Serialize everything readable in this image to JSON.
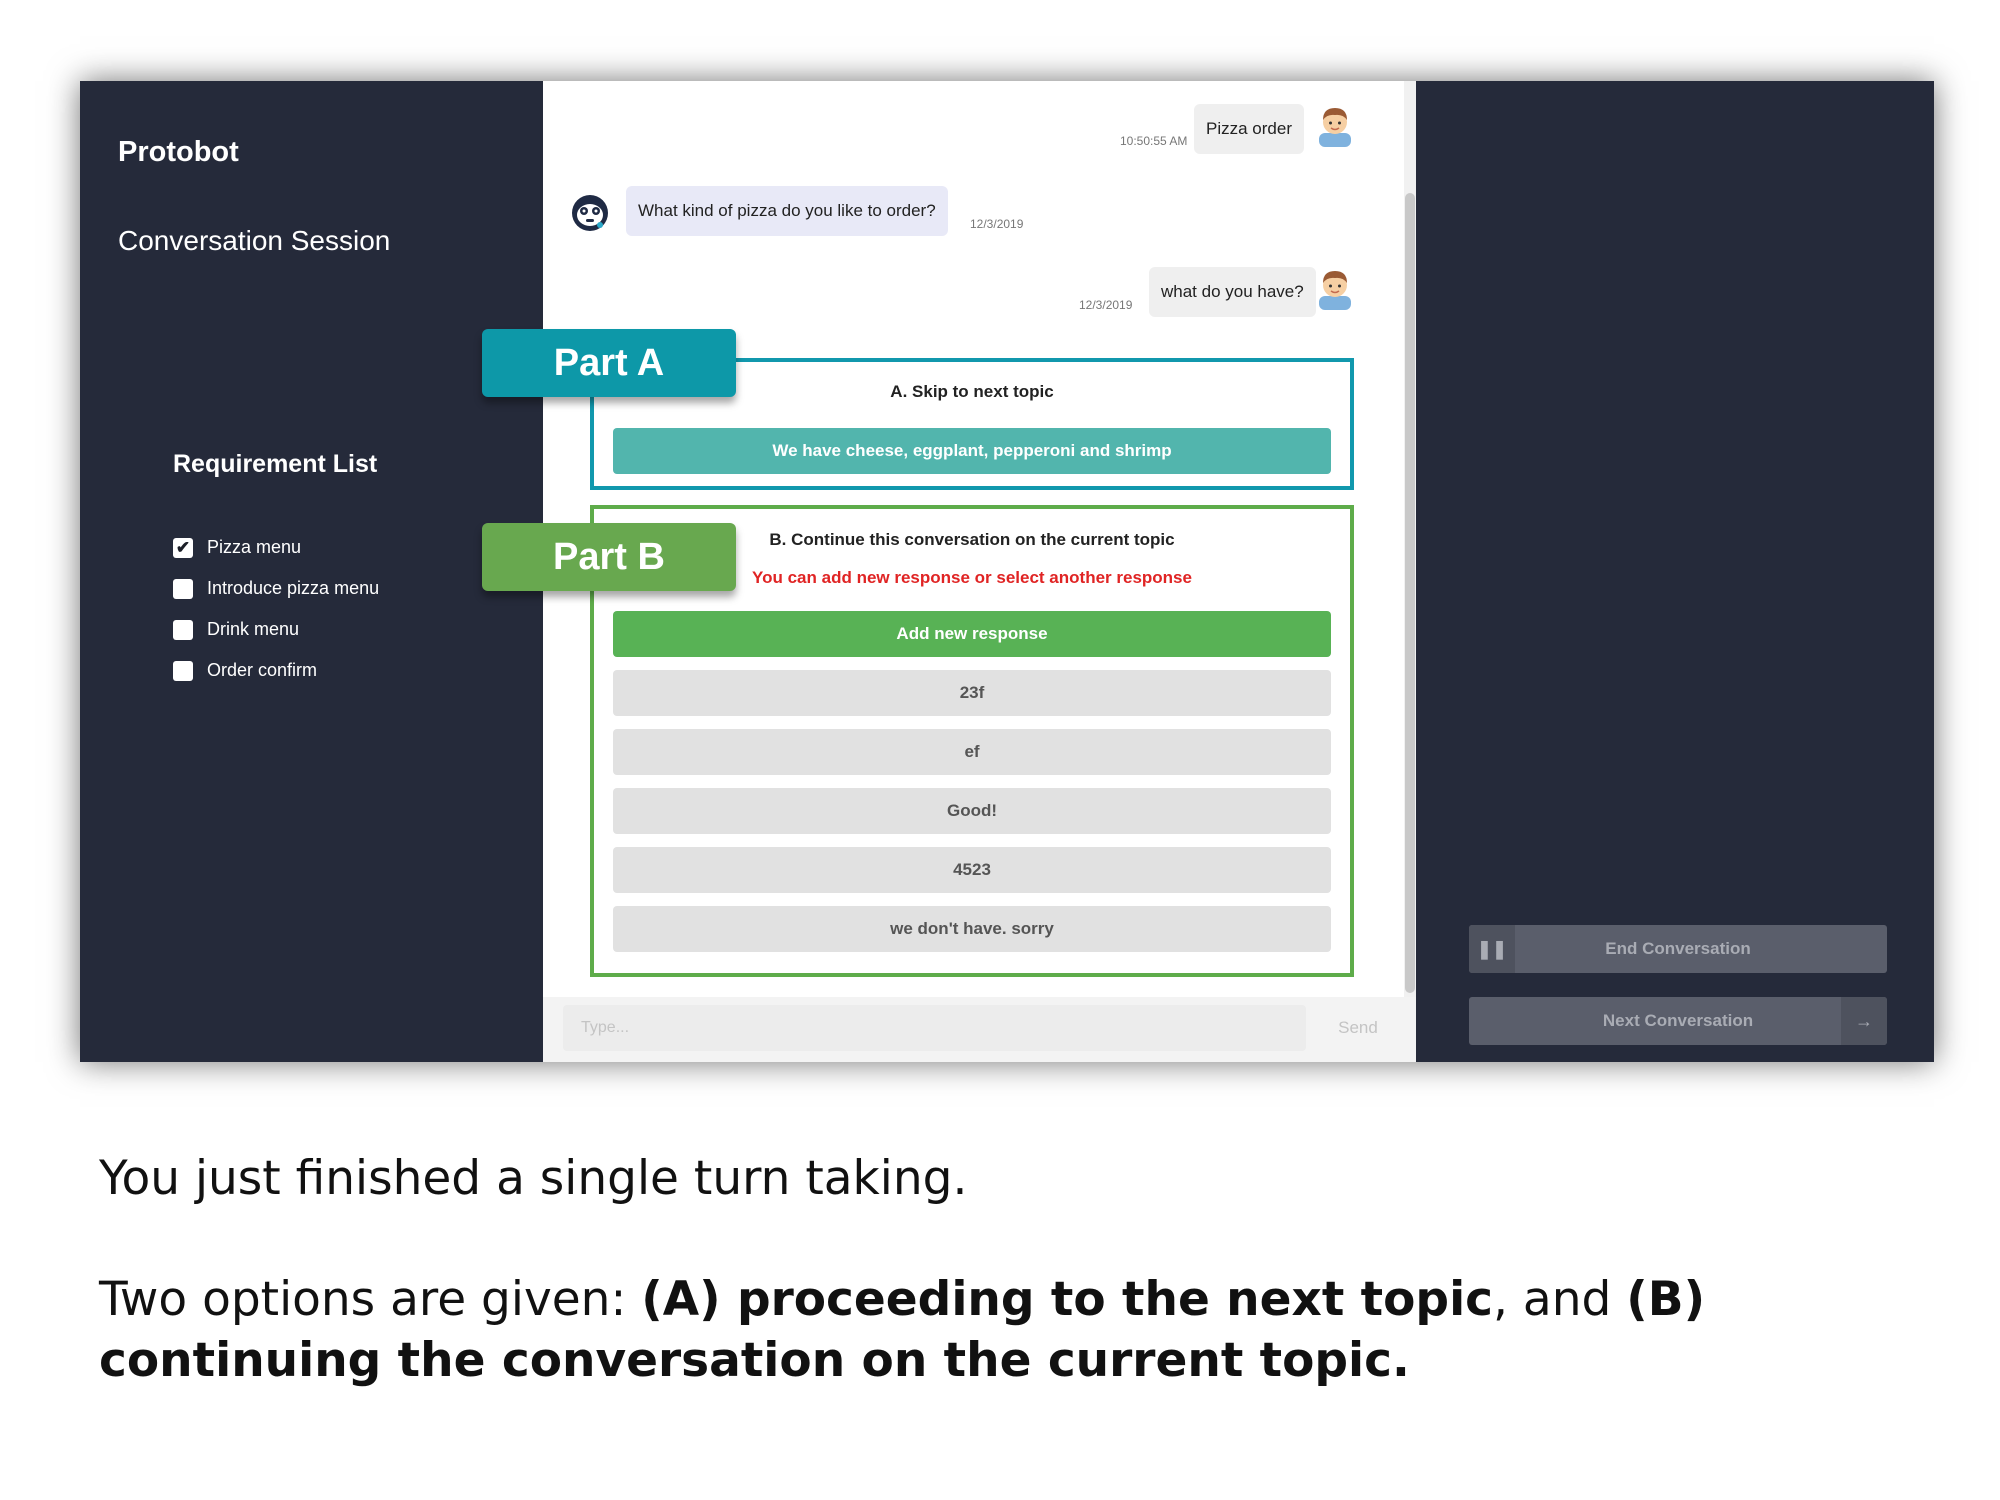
{
  "app": {
    "brand": "Protobot",
    "session_title": "Conversation Session",
    "requirements": {
      "title": "Requirement List",
      "items": [
        {
          "label": "Pizza menu",
          "checked": true
        },
        {
          "label": "Introduce pizza menu",
          "checked": false
        },
        {
          "label": "Drink menu",
          "checked": false
        },
        {
          "label": "Order confirm",
          "checked": false
        }
      ]
    }
  },
  "chat": {
    "messages": [
      {
        "sender": "user",
        "text": "Pizza order",
        "timestamp": "10:50:55 AM"
      },
      {
        "sender": "bot",
        "text": "What kind of pizza do you like to order?",
        "timestamp": "12/3/2019"
      },
      {
        "sender": "user",
        "text": "what do you have?",
        "timestamp": "12/3/2019"
      }
    ],
    "part_a": {
      "label": "Part A",
      "title": "A. Skip to next topic",
      "option": "We have cheese, eggplant, pepperoni and shrimp"
    },
    "part_b": {
      "label": "Part B",
      "title": "B. Continue this conversation on the current topic",
      "note": "You can add new response or select another response",
      "add_button": "Add new response",
      "responses": [
        "23f",
        "ef",
        "Good!",
        "4523",
        "we don't have. sorry"
      ]
    },
    "input": {
      "placeholder": "Type...",
      "send_label": "Send"
    }
  },
  "controls": {
    "end_label": "End Conversation",
    "next_label": "Next Conversation",
    "pause_icon": "pause-icon",
    "arrow_icon": "arrow-right-icon"
  },
  "caption": {
    "line1": "You just finished a single turn taking.",
    "line2_intro": "Two options are given: ",
    "line2_a": "(A) proceeding to the next topic",
    "line2_mid": ", and ",
    "line2_b": "(B) continuing the conversation on the current topic."
  }
}
